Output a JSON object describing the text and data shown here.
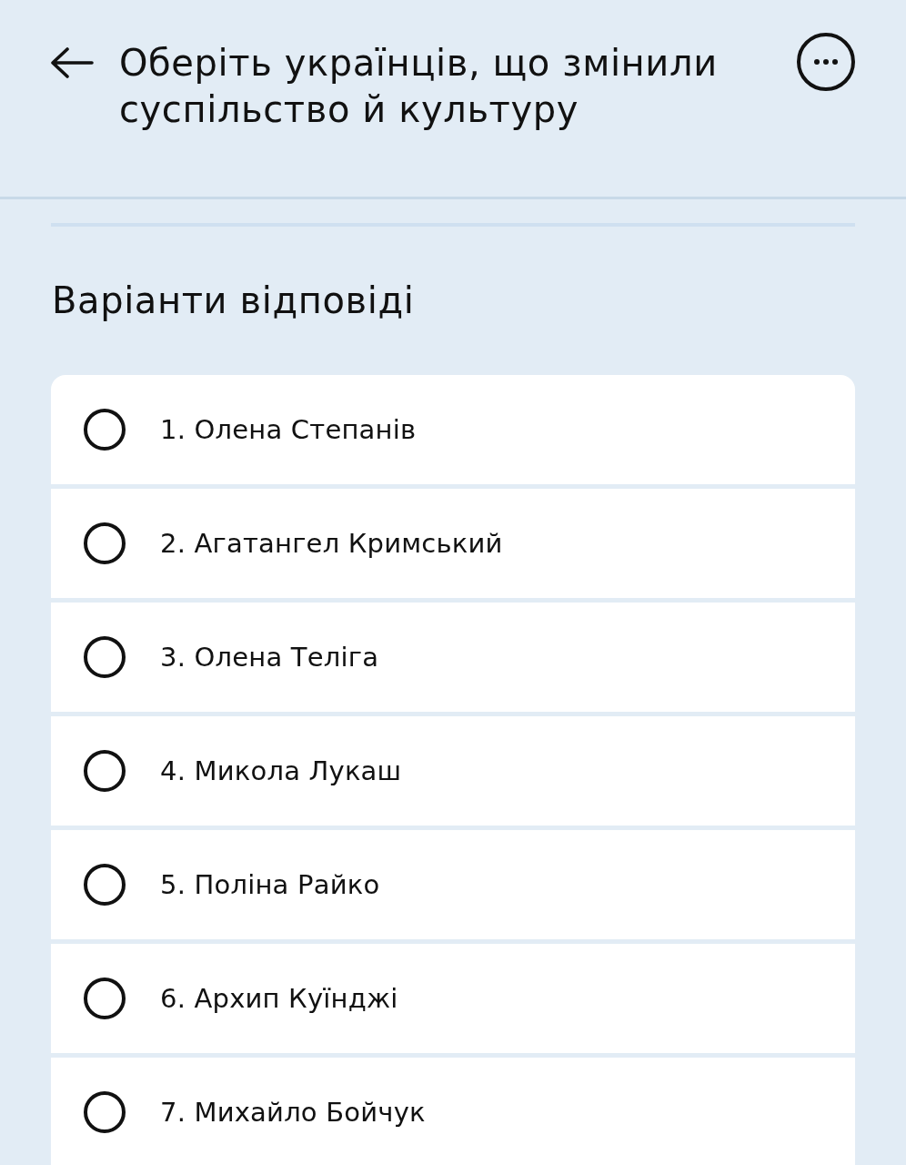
{
  "header": {
    "title": "Оберіть українців, що змінили суспільство й культуру"
  },
  "section": {
    "heading": "Варіанти відповіді"
  },
  "options": [
    {
      "label": "1. Олена Степанів",
      "selected": false
    },
    {
      "label": "2. Агатангел Кримський",
      "selected": false
    },
    {
      "label": "3. Олена Теліга",
      "selected": false
    },
    {
      "label": "4. Микола Лукаш",
      "selected": false
    },
    {
      "label": "5. Поліна Райко",
      "selected": false
    },
    {
      "label": "6. Архип Куїнджі",
      "selected": false
    },
    {
      "label": "7. Михайло Бойчук",
      "selected": false
    }
  ]
}
